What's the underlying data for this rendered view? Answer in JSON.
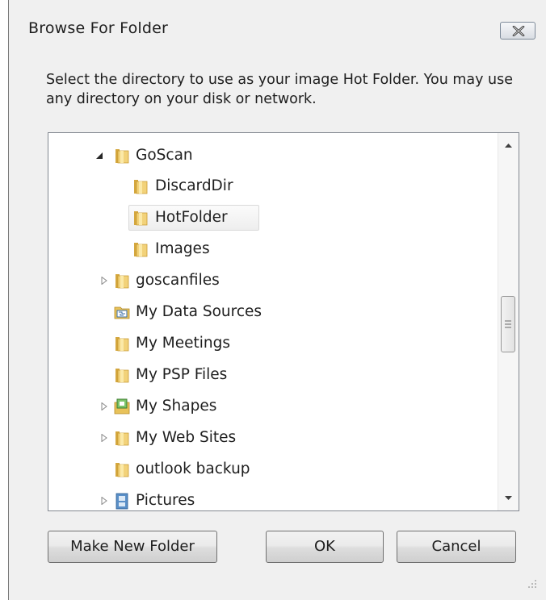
{
  "dialog": {
    "title": "Browse For Folder",
    "description": "Select the directory to use as your image Hot Folder.  You may use any directory on your disk or network."
  },
  "tree": {
    "items": [
      {
        "label": "GoScan",
        "expander": "expanded",
        "icon": "folder-icon"
      },
      {
        "label": "DiscardDir",
        "expander": "none",
        "icon": "folder-icon"
      },
      {
        "label": "HotFolder",
        "expander": "none",
        "icon": "folder-icon",
        "selected": true
      },
      {
        "label": "Images",
        "expander": "none",
        "icon": "folder-icon"
      },
      {
        "label": "goscanfiles",
        "expander": "collapsed",
        "icon": "folder-icon"
      },
      {
        "label": "My Data Sources",
        "expander": "none",
        "icon": "data-sources-folder-icon"
      },
      {
        "label": "My Meetings",
        "expander": "none",
        "icon": "folder-icon"
      },
      {
        "label": "My PSP Files",
        "expander": "none",
        "icon": "folder-icon"
      },
      {
        "label": "My Shapes",
        "expander": "collapsed",
        "icon": "shapes-folder-icon"
      },
      {
        "label": "My Web Sites",
        "expander": "collapsed",
        "icon": "folder-icon"
      },
      {
        "label": "outlook backup",
        "expander": "none",
        "icon": "folder-icon"
      },
      {
        "label": "Pictures",
        "expander": "collapsed",
        "icon": "pictures-library-icon"
      }
    ]
  },
  "buttons": {
    "make_new_folder": "Make New Folder",
    "ok": "OK",
    "cancel": "Cancel"
  },
  "colors": {
    "dialog_bg": "#f0f0f0",
    "folder_yellow": "#e8c25a",
    "selection_border": "#d9d9d9"
  }
}
